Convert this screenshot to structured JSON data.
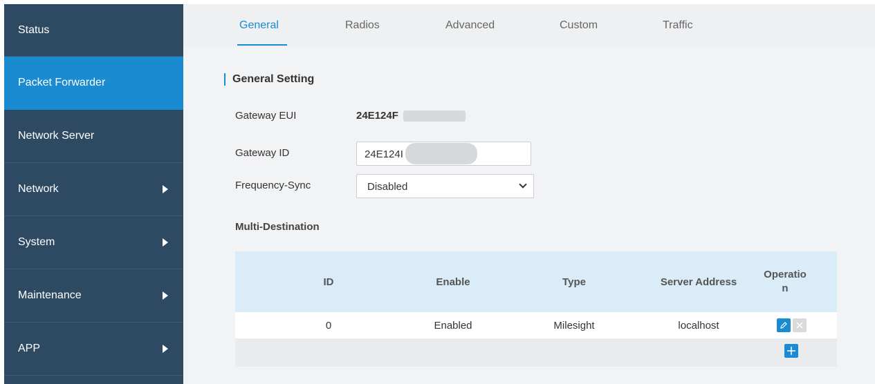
{
  "sidebar": {
    "items": [
      {
        "label": "Status"
      },
      {
        "label": "Packet Forwarder"
      },
      {
        "label": "Network Server"
      },
      {
        "label": "Network"
      },
      {
        "label": "System"
      },
      {
        "label": "Maintenance"
      },
      {
        "label": "APP"
      }
    ],
    "active_index": 1
  },
  "tabs": [
    {
      "label": "General"
    },
    {
      "label": "Radios"
    },
    {
      "label": "Advanced"
    },
    {
      "label": "Custom"
    },
    {
      "label": "Traffic"
    }
  ],
  "section": {
    "title": "General Setting"
  },
  "form": {
    "gateway_eui_label": "Gateway EUI",
    "gateway_eui_value": "24E124F",
    "gateway_id_label": "Gateway ID",
    "gateway_id_value": "24E124I",
    "frequency_sync_label": "Frequency-Sync",
    "frequency_sync_value": "Disabled"
  },
  "multi_destination": {
    "title": "Multi-Destination",
    "columns": [
      "ID",
      "Enable",
      "Type",
      "Server Address",
      "Operatio\nn"
    ],
    "rows": [
      {
        "id": "0",
        "enable": "Enabled",
        "type": "Milesight",
        "server_address": "localhost"
      }
    ]
  },
  "icons": {
    "edit": "pencil-icon",
    "delete": "close-icon",
    "add": "plus-icon",
    "expand": "caret-right-icon",
    "dropdown": "chevron-down-icon"
  },
  "colors": {
    "accent": "#1a8bd0",
    "sidebar_bg": "#2e4a63",
    "table_header_bg": "#d9ecf7"
  }
}
